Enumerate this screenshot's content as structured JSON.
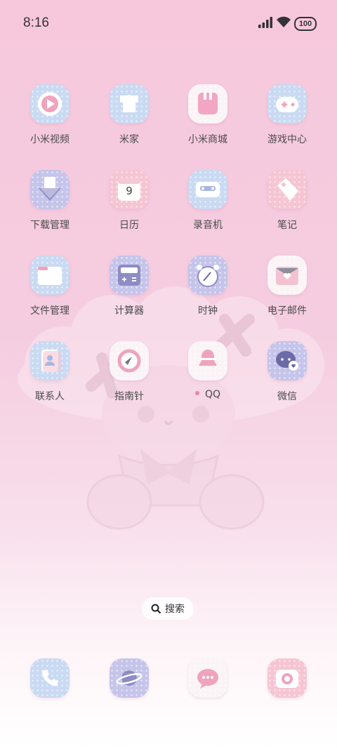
{
  "status": {
    "time": "8:16",
    "battery": "100"
  },
  "apps": [
    {
      "label": "小米视频"
    },
    {
      "label": "米家"
    },
    {
      "label": "小米商城"
    },
    {
      "label": "游戏中心"
    },
    {
      "label": "下载管理"
    },
    {
      "label": "日历",
      "date": "9"
    },
    {
      "label": "录音机"
    },
    {
      "label": "笔记"
    },
    {
      "label": "文件管理"
    },
    {
      "label": "计算器"
    },
    {
      "label": "时钟"
    },
    {
      "label": "电子邮件"
    },
    {
      "label": "联系人"
    },
    {
      "label": "指南针"
    },
    {
      "label": "QQ"
    },
    {
      "label": "微信"
    }
  ],
  "dock": [
    {
      "icon": "phone-icon"
    },
    {
      "icon": "browser-icon"
    },
    {
      "icon": "messages-icon"
    },
    {
      "icon": "camera-icon"
    }
  ],
  "search": {
    "label": "搜索"
  },
  "colors": {
    "tile_blue": "#c9daf2",
    "tile_pink": "#f6c5d3",
    "tile_lavender": "#c5c4ea",
    "accent_pink": "#e985ab"
  }
}
